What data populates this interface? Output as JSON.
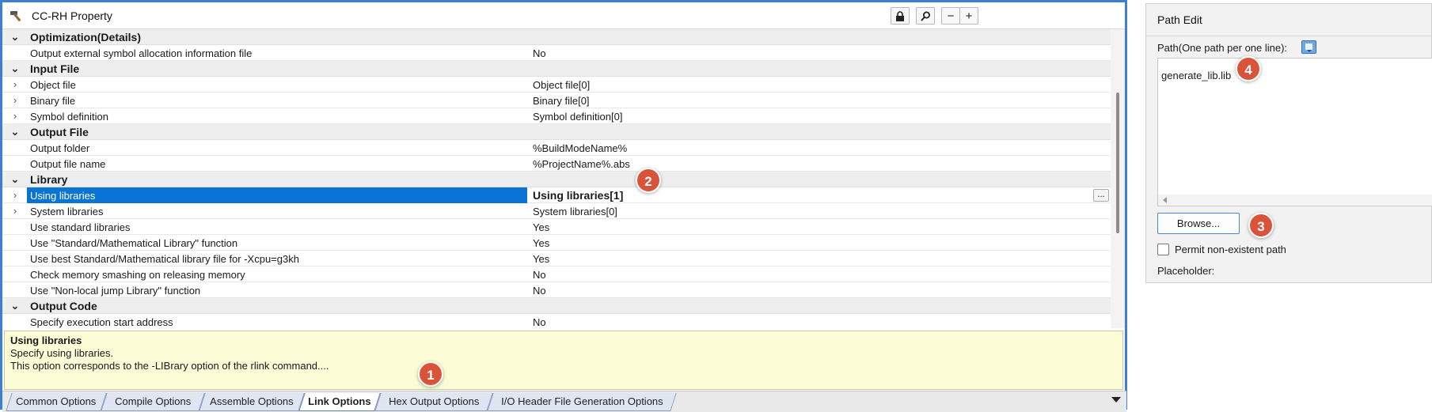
{
  "window": {
    "title": "CC-RH Property",
    "icon": "hammer-icon",
    "toolbar": {
      "lock_icon": "lock-icon",
      "search_icon": "search-icon",
      "collapse_label": "−",
      "expand_label": "+"
    }
  },
  "grid": {
    "rows": [
      {
        "kind": "category",
        "expander": "⌄",
        "name": "Optimization(Details)",
        "value": ""
      },
      {
        "kind": "item",
        "expander": "",
        "name": "Output external symbol allocation information file",
        "value": "No"
      },
      {
        "kind": "category",
        "expander": "⌄",
        "name": "Input File",
        "value": ""
      },
      {
        "kind": "item",
        "expander": "›",
        "name": "Object file",
        "value": "Object file[0]"
      },
      {
        "kind": "item",
        "expander": "›",
        "name": "Binary file",
        "value": "Binary file[0]"
      },
      {
        "kind": "item",
        "expander": "›",
        "name": "Symbol definition",
        "value": "Symbol definition[0]"
      },
      {
        "kind": "category",
        "expander": "⌄",
        "name": "Output File",
        "value": ""
      },
      {
        "kind": "item",
        "expander": "",
        "name": "Output folder",
        "value": "%BuildModeName%"
      },
      {
        "kind": "item",
        "expander": "",
        "name": "Output file name",
        "value": "%ProjectName%.abs"
      },
      {
        "kind": "category",
        "expander": "⌄",
        "name": "Library",
        "value": ""
      },
      {
        "kind": "selected",
        "expander": "›",
        "name": "Using libraries",
        "value": "Using libraries[1]",
        "button": "..."
      },
      {
        "kind": "item",
        "expander": "›",
        "name": "System libraries",
        "value": "System libraries[0]"
      },
      {
        "kind": "item",
        "expander": "",
        "name": "Use standard libraries",
        "value": "Yes"
      },
      {
        "kind": "item",
        "expander": "",
        "name": "Use \"Standard/Mathematical Library\" function",
        "value": "Yes"
      },
      {
        "kind": "item",
        "expander": "",
        "name": "Use best Standard/Mathematical library file for -Xcpu=g3kh",
        "value": "Yes"
      },
      {
        "kind": "item",
        "expander": "",
        "name": "Check memory smashing on releasing memory",
        "value": "No"
      },
      {
        "kind": "item",
        "expander": "",
        "name": "Use \"Non-local jump Library\" function",
        "value": "No"
      },
      {
        "kind": "category",
        "expander": "⌄",
        "name": "Output Code",
        "value": ""
      },
      {
        "kind": "item",
        "expander": "",
        "name": "Specify execution start address",
        "value": "No"
      }
    ]
  },
  "description": {
    "title": "Using libraries",
    "line1": "Specify using libraries.",
    "line2": "This option corresponds to the -LIBrary option of the rlink command...."
  },
  "tabs": [
    {
      "label": "Common Options",
      "active": false
    },
    {
      "label": "Compile Options",
      "active": false
    },
    {
      "label": "Assemble Options",
      "active": false
    },
    {
      "label": "Link Options",
      "active": true
    },
    {
      "label": "Hex Output Options",
      "active": false
    },
    {
      "label": "I/O Header File Generation Options",
      "active": false
    }
  ],
  "path_edit": {
    "title": "Path Edit",
    "label": "Path(One path per one line):",
    "macro_icon": "insert-macro-icon",
    "text": "generate_lib.lib",
    "browse_label": "Browse...",
    "permit_label": "Permit non-existent path",
    "permit_checked": false,
    "placeholder_label": "Placeholder:"
  },
  "callouts": [
    "1",
    "2",
    "3",
    "4"
  ],
  "colors": {
    "accent": "#0a74d6",
    "callout": "#d9533b",
    "description_bg": "#fcfcd6"
  }
}
